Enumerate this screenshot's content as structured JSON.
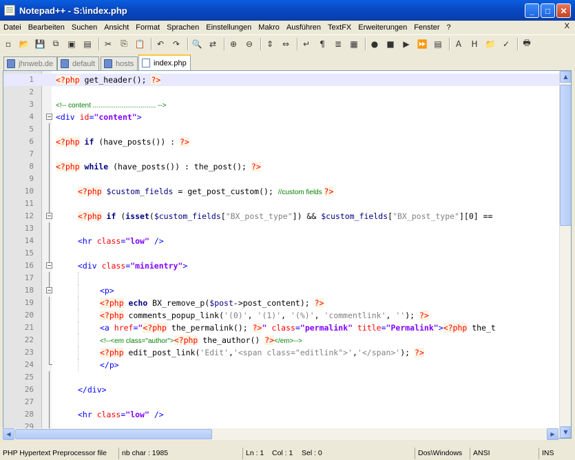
{
  "window": {
    "title": "Notepad++ - S:\\index.php",
    "minimize": "_",
    "maximize": "□",
    "close": "✕"
  },
  "menu": {
    "items": [
      "Datei",
      "Bearbeiten",
      "Suchen",
      "Ansicht",
      "Format",
      "Sprachen",
      "Einstellungen",
      "Makro",
      "Ausführen",
      "TextFX",
      "Erweiterungen",
      "Fenster",
      "?"
    ],
    "close": "X"
  },
  "toolbar": {
    "buttons": [
      {
        "name": "new-file-icon",
        "glyph": "▫"
      },
      {
        "name": "open-file-icon",
        "glyph": "📂"
      },
      {
        "name": "save-icon",
        "glyph": "💾"
      },
      {
        "name": "save-all-icon",
        "glyph": "⧉"
      },
      {
        "name": "close-file-icon",
        "glyph": "▣"
      },
      {
        "name": "close-all-icon",
        "glyph": "▤"
      },
      {
        "sep": true
      },
      {
        "name": "cut-icon",
        "glyph": "✂"
      },
      {
        "name": "copy-icon",
        "glyph": "⎘"
      },
      {
        "name": "paste-icon",
        "glyph": "📋"
      },
      {
        "sep": true
      },
      {
        "name": "undo-icon",
        "glyph": "↶"
      },
      {
        "name": "redo-icon",
        "glyph": "↷"
      },
      {
        "sep": true
      },
      {
        "name": "find-icon",
        "glyph": "🔍"
      },
      {
        "name": "replace-icon",
        "glyph": "⇄"
      },
      {
        "sep": true
      },
      {
        "name": "zoom-in-icon",
        "glyph": "⊕"
      },
      {
        "name": "zoom-out-icon",
        "glyph": "⊖"
      },
      {
        "sep": true
      },
      {
        "name": "sync-vertical-icon",
        "glyph": "⇕"
      },
      {
        "name": "sync-horizontal-icon",
        "glyph": "⇔"
      },
      {
        "sep": true
      },
      {
        "name": "word-wrap-icon",
        "glyph": "↵"
      },
      {
        "name": "show-all-chars-icon",
        "glyph": "¶"
      },
      {
        "name": "indent-guide-icon",
        "glyph": "≣"
      },
      {
        "name": "user-lang-icon",
        "glyph": "▦"
      },
      {
        "sep": true
      },
      {
        "name": "record-macro-icon",
        "glyph": "●"
      },
      {
        "name": "stop-macro-icon",
        "glyph": "■"
      },
      {
        "name": "play-macro-icon",
        "glyph": "▶"
      },
      {
        "name": "run-macro-multiple-icon",
        "glyph": "⏩"
      },
      {
        "name": "save-macro-icon",
        "glyph": "▤"
      },
      {
        "sep": true
      },
      {
        "name": "tool-a-icon",
        "glyph": "A"
      },
      {
        "name": "tool-h-icon",
        "glyph": "H"
      },
      {
        "name": "folder-icon",
        "glyph": "📁"
      },
      {
        "name": "spellcheck-icon",
        "glyph": "✓"
      },
      {
        "sep": true
      },
      {
        "name": "print-icon",
        "glyph": "🖶"
      }
    ]
  },
  "tabs": [
    {
      "label": "jhnweb.de",
      "active": false
    },
    {
      "label": "default",
      "active": false
    },
    {
      "label": "hosts",
      "active": false
    },
    {
      "label": "index.php",
      "active": true
    }
  ],
  "lines": [
    {
      "n": "1",
      "current": true,
      "indent": 0,
      "fold": "",
      "segs": [
        [
          "php",
          "<?php"
        ],
        [
          "fn",
          " get_header(); "
        ],
        [
          "php",
          "?>"
        ]
      ]
    },
    {
      "n": "2",
      "indent": 0,
      "fold": "",
      "segs": []
    },
    {
      "n": "3",
      "indent": 0,
      "fold": "",
      "segs": [
        [
          "cmt",
          "<!-- content ................................. -->"
        ]
      ]
    },
    {
      "n": "4",
      "indent": 0,
      "fold": "box",
      "segs": [
        [
          "tag",
          "<div "
        ],
        [
          "attr",
          "id"
        ],
        [
          "tag",
          "="
        ],
        [
          "val",
          "\"content\""
        ],
        [
          "tag",
          ">"
        ]
      ]
    },
    {
      "n": "5",
      "indent": 0,
      "fold": "v",
      "segs": []
    },
    {
      "n": "6",
      "indent": 0,
      "fold": "v",
      "segs": [
        [
          "php",
          "<?php"
        ],
        [
          "kw",
          " if"
        ],
        [
          "fn",
          " (have_posts()) : "
        ],
        [
          "php",
          "?>"
        ]
      ]
    },
    {
      "n": "7",
      "indent": 0,
      "fold": "v",
      "segs": []
    },
    {
      "n": "8",
      "indent": 0,
      "fold": "v",
      "segs": [
        [
          "php",
          "<?php"
        ],
        [
          "kw",
          " while"
        ],
        [
          "fn",
          " (have_posts()) : the_post(); "
        ],
        [
          "php",
          "?>"
        ]
      ]
    },
    {
      "n": "9",
      "indent": 0,
      "fold": "v",
      "segs": []
    },
    {
      "n": "10",
      "indent": 1,
      "fold": "v",
      "segs": [
        [
          "php",
          "<?php"
        ],
        [
          "var",
          " $custom_fields"
        ],
        [
          "fn",
          " = get_post_custom(); "
        ],
        [
          "cmt",
          "//custom fields "
        ],
        [
          "php",
          "?>"
        ]
      ]
    },
    {
      "n": "11",
      "indent": 1,
      "fold": "v",
      "segs": []
    },
    {
      "n": "12",
      "indent": 1,
      "fold": "box",
      "segs": [
        [
          "php",
          "<?php"
        ],
        [
          "kw",
          " if"
        ],
        [
          "fn",
          " ("
        ],
        [
          "kw",
          "isset"
        ],
        [
          "fn",
          "("
        ],
        [
          "var",
          "$custom_fields"
        ],
        [
          "fn",
          "["
        ],
        [
          "str",
          "\"BX_post_type\""
        ],
        [
          "fn",
          "]) && "
        ],
        [
          "var",
          "$custom_fields"
        ],
        [
          "fn",
          "["
        ],
        [
          "str",
          "\"BX_post_type\""
        ],
        [
          "fn",
          "][0] == "
        ]
      ]
    },
    {
      "n": "13",
      "indent": 1,
      "fold": "v",
      "segs": []
    },
    {
      "n": "14",
      "indent": 1,
      "fold": "v",
      "segs": [
        [
          "tag",
          "<hr "
        ],
        [
          "attr",
          "class"
        ],
        [
          "tag",
          "="
        ],
        [
          "val",
          "\"low\""
        ],
        [
          "tag",
          " />"
        ]
      ]
    },
    {
      "n": "15",
      "indent": 1,
      "fold": "v",
      "segs": []
    },
    {
      "n": "16",
      "indent": 1,
      "fold": "box",
      "segs": [
        [
          "tag",
          "<div "
        ],
        [
          "attr",
          "class"
        ],
        [
          "tag",
          "="
        ],
        [
          "val",
          "\"minientry\""
        ],
        [
          "tag",
          ">"
        ]
      ]
    },
    {
      "n": "17",
      "indent": 2,
      "fold": "v",
      "segs": []
    },
    {
      "n": "18",
      "indent": 2,
      "fold": "box",
      "segs": [
        [
          "tag",
          "<p>"
        ]
      ]
    },
    {
      "n": "19",
      "indent": 2,
      "fold": "v",
      "segs": [
        [
          "php",
          "<?php"
        ],
        [
          "kw",
          " echo"
        ],
        [
          "fn",
          " BX_remove_p("
        ],
        [
          "var",
          "$post"
        ],
        [
          "fn",
          "->post_content); "
        ],
        [
          "php",
          "?>"
        ]
      ]
    },
    {
      "n": "20",
      "indent": 2,
      "fold": "v",
      "segs": [
        [
          "php",
          "<?php"
        ],
        [
          "fn",
          " comments_popup_link("
        ],
        [
          "str",
          "'(0)'"
        ],
        [
          "fn",
          ", "
        ],
        [
          "str",
          "'(1)'"
        ],
        [
          "fn",
          ", "
        ],
        [
          "str",
          "'(%)'"
        ],
        [
          "fn",
          ", "
        ],
        [
          "str",
          "'commentlink'"
        ],
        [
          "fn",
          ", "
        ],
        [
          "str",
          "''"
        ],
        [
          "fn",
          "); "
        ],
        [
          "php",
          "?>"
        ]
      ]
    },
    {
      "n": "21",
      "indent": 2,
      "fold": "v",
      "segs": [
        [
          "tag",
          "<a "
        ],
        [
          "attr",
          "href"
        ],
        [
          "tag",
          "="
        ],
        [
          "val",
          "\""
        ],
        [
          "php",
          "<?php"
        ],
        [
          "fn",
          " the_permalink(); "
        ],
        [
          "php",
          "?>"
        ],
        [
          "val",
          "\""
        ],
        [
          "attr",
          " class"
        ],
        [
          "tag",
          "="
        ],
        [
          "val",
          "\"permalink\""
        ],
        [
          "attr",
          " title"
        ],
        [
          "tag",
          "="
        ],
        [
          "val",
          "\"Permalink\""
        ],
        [
          "tag",
          ">"
        ],
        [
          "php",
          "<?php"
        ],
        [
          "fn",
          " the_t"
        ]
      ]
    },
    {
      "n": "22",
      "indent": 2,
      "fold": "v",
      "segs": [
        [
          "cmt",
          "<!--<em class=\"author\">"
        ],
        [
          "php",
          "<?php"
        ],
        [
          "fn",
          " the_author() "
        ],
        [
          "php",
          "?>"
        ],
        [
          "cmt",
          "</em>-->"
        ]
      ]
    },
    {
      "n": "23",
      "indent": 2,
      "fold": "v",
      "segs": [
        [
          "php",
          "<?php"
        ],
        [
          "fn",
          " edit_post_link("
        ],
        [
          "str",
          "'Edit'"
        ],
        [
          "fn",
          ","
        ],
        [
          "str",
          "'<span class=\"editlink\">'"
        ],
        [
          "fn",
          ","
        ],
        [
          "str",
          "'</span>'"
        ],
        [
          "fn",
          "); "
        ],
        [
          "php",
          "?>"
        ]
      ]
    },
    {
      "n": "24",
      "indent": 2,
      "fold": "end",
      "segs": [
        [
          "tag",
          "</p>"
        ]
      ]
    },
    {
      "n": "25",
      "indent": 1,
      "fold": "v",
      "segs": []
    },
    {
      "n": "26",
      "indent": 1,
      "fold": "v",
      "segs": [
        [
          "tag",
          "</div>"
        ]
      ]
    },
    {
      "n": "27",
      "indent": 1,
      "fold": "v",
      "segs": []
    },
    {
      "n": "28",
      "indent": 1,
      "fold": "v",
      "segs": [
        [
          "tag",
          "<hr "
        ],
        [
          "attr",
          "class"
        ],
        [
          "tag",
          "="
        ],
        [
          "val",
          "\"low\""
        ],
        [
          "tag",
          " />"
        ]
      ]
    },
    {
      "n": "29",
      "indent": 1,
      "fold": "v",
      "segs": []
    }
  ],
  "status": {
    "language": "PHP Hypertext Preprocessor file",
    "chars": "nb char : 1985",
    "ln": "Ln : 1",
    "col": "Col : 1",
    "sel": "Sel : 0",
    "eol": "Dos\\Windows",
    "encoding": "ANSI",
    "mode": "INS"
  },
  "scroll": {
    "up": "▲",
    "down": "▼",
    "left": "◀",
    "right": "▶"
  }
}
